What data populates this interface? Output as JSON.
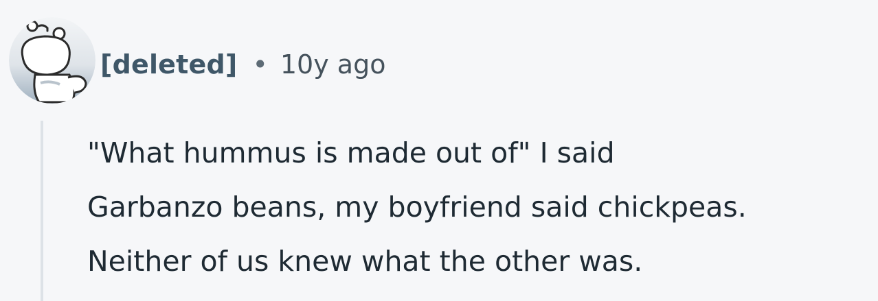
{
  "comment": {
    "author": "[deleted]",
    "separator": "•",
    "time": "10y ago",
    "avatar_icon": "deleted-user-snoo-icon",
    "body_lines": [
      "\"What hummus is made out of\" I said",
      "Garbanzo beans, my boyfriend said chickpeas.",
      "Neither of us knew what the other was."
    ]
  },
  "colors": {
    "background": "#f6f7f9",
    "author": "#3f5768",
    "text": "#1e2a33",
    "thread_line": "#dde2e7"
  }
}
